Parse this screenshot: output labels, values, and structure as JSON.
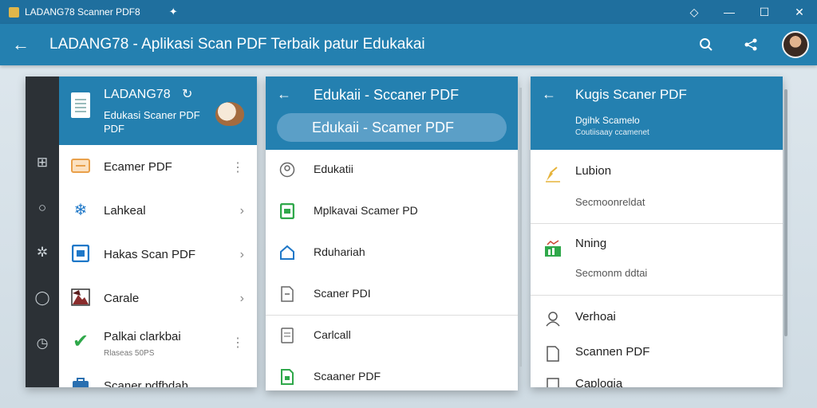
{
  "window": {
    "title": "LADANG78 Scanner PDF8",
    "controls": [
      "minimize",
      "maximize",
      "close"
    ]
  },
  "appbar": {
    "title": "LADANG78 - Aplikasi Scan PDF Terbaik patur Edukakai",
    "icons": [
      "back-arrow-icon",
      "search-icon",
      "share-icon"
    ]
  },
  "panel1": {
    "app_name": "LADANG78",
    "subtitle_line1": "Edukasi Scaner PDF",
    "subtitle_line2": "PDF",
    "rail_icons": [
      "grid-icon",
      "circle-icon",
      "gear-icon",
      "location-icon",
      "clock-icon"
    ],
    "items": [
      {
        "label": "Ecamer PDF",
        "trail": "⋮",
        "icon": "document-icon",
        "color": "#e9a04a"
      },
      {
        "label": "Lahkeal",
        "trail": "›",
        "icon": "snowflake-icon",
        "color": "#1f78c8"
      },
      {
        "label": "Hakas Scan PDF",
        "trail": "›",
        "icon": "scan-icon",
        "color": "#1f78c8"
      },
      {
        "label": "Carale",
        "trail": "›",
        "icon": "image-icon",
        "color": "#8a2d2d"
      },
      {
        "label": "Palkai clarkbai",
        "sublabel": "Rlaseas 50PS",
        "trail": "⋮",
        "icon": "check-icon",
        "color": "#2fa84a"
      },
      {
        "label": "Scaner pdfbdah",
        "trail": "",
        "icon": "briefcase-icon",
        "color": "#2a6fb0"
      }
    ]
  },
  "panel2": {
    "title": "Edukaii - Sccaner PDF",
    "search_value": "Edukaii  - Scamer PDF",
    "items": [
      {
        "label": "Edukatii",
        "icon": "user-circle-icon",
        "color": "#666"
      },
      {
        "label": "Mplkavai Scamer PD",
        "icon": "file-green-icon",
        "color": "#2fa84a"
      },
      {
        "label": "Rduhariah",
        "icon": "home-icon",
        "color": "#1f78c8"
      },
      {
        "label": "Scaner PDI",
        "icon": "file-icon",
        "color": "#666"
      },
      {
        "label": "Carlcall",
        "icon": "file-lines-icon",
        "color": "#666"
      },
      {
        "label": "Scaaner PDF",
        "icon": "file-green-icon",
        "color": "#2fa84a"
      }
    ]
  },
  "panel3": {
    "title": "Kugis Scaner PDF",
    "subtitle1": "Dgihk Scamelo",
    "subtitle2": "Coutiisaay ccamenet",
    "groups": [
      {
        "label": "Lubion",
        "sublabel": "Secmoonreldat",
        "icon": "pen-icon",
        "color": "#e6b33a"
      },
      {
        "label": "Nning",
        "sublabel": "Secmonm ddtai",
        "icon": "chart-icon",
        "color": "#2fa84a"
      }
    ],
    "items": [
      {
        "label": "Verhoai",
        "icon": "person-icon",
        "color": "#555"
      },
      {
        "label": "Scannen PDF",
        "icon": "file-icon",
        "color": "#555"
      },
      {
        "label": "Caplogia",
        "icon": "file-lines-icon",
        "color": "#555"
      }
    ]
  }
}
